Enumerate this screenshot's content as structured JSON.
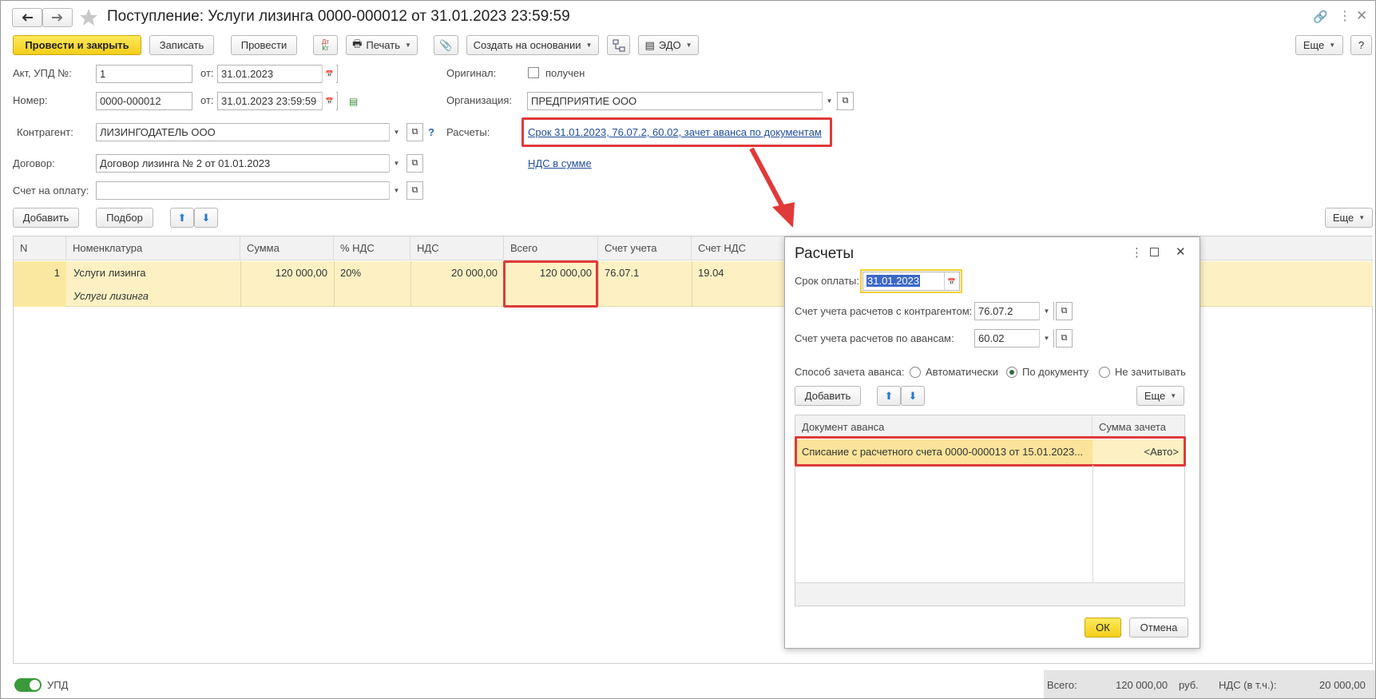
{
  "window": {
    "title": "Поступление: Услуги лизинга 0000-000012 от 31.01.2023 23:59:59"
  },
  "toolbar": {
    "post_close": "Провести и закрыть",
    "save": "Записать",
    "post": "Провести",
    "dtkt": "Дт Кт",
    "print": "Печать",
    "create_based": "Создать на основании",
    "edo": "ЭДО",
    "more": "Еще",
    "help": "?"
  },
  "form": {
    "act_label": "Акт, УПД №:",
    "act_value": "1",
    "from_label": "от:",
    "act_date": "31.01.2023",
    "number_label": "Номер:",
    "number_value": "0000-000012",
    "number_date": "31.01.2023 23:59:59",
    "counterparty_label": "Контрагент:",
    "counterparty_value": "ЛИЗИНГОДАТЕЛЬ ООО",
    "contract_label": "Договор:",
    "contract_value": "Договор лизинга № 2 от 01.01.2023",
    "invoice_label": "Счет на оплату:",
    "invoice_value": "",
    "original_label": "Оригинал:",
    "original_checkbox": "получен",
    "org_label": "Организация:",
    "org_value": "ПРЕДПРИЯТИЕ ООО",
    "payments_label": "Расчеты:",
    "payments_link": "Срок 31.01.2023, 76.07.2, 60.02, зачет аванса по документам",
    "vat_link": "НДС в сумме",
    "question": "?"
  },
  "table_toolbar": {
    "add": "Добавить",
    "pick": "Подбор",
    "more": "Еще"
  },
  "table": {
    "columns": [
      "N",
      "Номенклатура",
      "Сумма",
      "% НДС",
      "НДС",
      "Всего",
      "Счет учета",
      "Счет НДС"
    ],
    "rows": [
      {
        "n": "1",
        "item": "Услуги лизинга",
        "item_sub": "Услуги лизинга",
        "sum": "120 000,00",
        "vat_rate": "20%",
        "vat": "20 000,00",
        "total": "120 000,00",
        "account": "76.07.1",
        "vat_account": "19.04"
      }
    ]
  },
  "footer": {
    "upd_label": "УПД",
    "total_label": "Всего:",
    "total_value": "120 000,00",
    "currency": "руб.",
    "vat_label": "НДС (в т.ч.):",
    "vat_value": "20 000,00"
  },
  "dialog": {
    "title": "Расчеты",
    "due_label": "Срок оплаты:",
    "due_value": "31.01.2023",
    "acc_counterparty_label": "Счет учета расчетов с контрагентом:",
    "acc_counterparty_value": "76.07.2",
    "acc_advance_label": "Счет учета расчетов по авансам:",
    "acc_advance_value": "60.02",
    "offset_label": "Способ зачета аванса:",
    "offset_options": [
      "Автоматически",
      "По документу",
      "Не зачитывать"
    ],
    "offset_selected": "По документу",
    "add": "Добавить",
    "more": "Еще",
    "col_doc": "Документ аванса",
    "col_sum": "Сумма зачета",
    "row_doc": "Списание с расчетного счета 0000-000013 от 15.01.2023...",
    "row_sum": "<Авто>",
    "ok": "ОК",
    "cancel": "Отмена"
  },
  "colors": {
    "primary_button": "#f4ce1a",
    "highlight_row": "#fdf1c4",
    "link": "#1f4e9c",
    "annotation_red": "#e03a3a",
    "toggle_green": "#3a9a3a"
  }
}
